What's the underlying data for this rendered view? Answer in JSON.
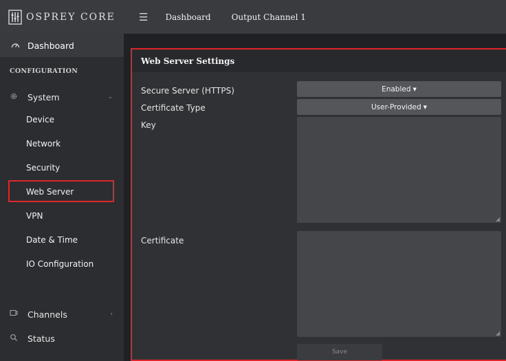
{
  "brand": {
    "logo_text": "OSPREY CORE"
  },
  "topbar": {
    "menu_icon": "hamburger-icon",
    "breadcrumb": [
      "Dashboard",
      "Output Channel 1"
    ]
  },
  "sidebar": {
    "dashboard": {
      "label": "Dashboard",
      "icon": "gauge-icon"
    },
    "section_title": "CONFIGURATION",
    "system": {
      "label": "System",
      "icon": "gear-icon",
      "expanded": true
    },
    "system_items": [
      {
        "label": "Device"
      },
      {
        "label": "Network"
      },
      {
        "label": "Security"
      },
      {
        "label": "Web Server",
        "active": true
      },
      {
        "label": "VPN"
      },
      {
        "label": "Date & Time"
      },
      {
        "label": "IO Configuration"
      }
    ],
    "channels": {
      "label": "Channels",
      "icon": "monitor-icon"
    },
    "status": {
      "label": "Status",
      "icon": "search-icon"
    }
  },
  "panel": {
    "title": "Web Server Settings",
    "secure_server": {
      "label": "Secure Server (HTTPS)",
      "value": "Enabled"
    },
    "certificate_type": {
      "label": "Certificate Type",
      "value": "User-Provided"
    },
    "key": {
      "label": "Key",
      "value": ""
    },
    "certificate": {
      "label": "Certificate",
      "value": ""
    },
    "save_label": "Save"
  },
  "colors": {
    "highlight": "#e0262b",
    "sidebar_bg": "#2c2d30",
    "panel_bg": "#303134"
  }
}
